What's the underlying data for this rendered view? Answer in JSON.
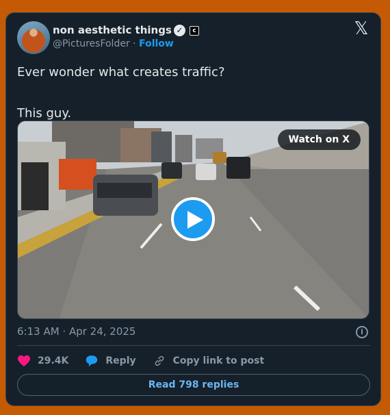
{
  "author": {
    "display_name": "non aesthetic things",
    "handle": "@PicturesFolder",
    "separator": "·",
    "follow_label": "Follow",
    "affiliate_badge": "c"
  },
  "tweet": {
    "line1": "Ever wonder what creates traffic?",
    "line2": "This guy."
  },
  "media": {
    "watch_label": "Watch on X",
    "play_icon": "play-icon"
  },
  "meta": {
    "timestamp": "6:13 AM · Apr 24, 2025"
  },
  "actions": {
    "likes": "29.4K",
    "reply_label": "Reply",
    "copy_label": "Copy link to post"
  },
  "replies_button": "Read 798 replies",
  "colors": {
    "background": "#c55a05",
    "card": "#15202b",
    "accent": "#1d9bf0",
    "like": "#f91880"
  }
}
